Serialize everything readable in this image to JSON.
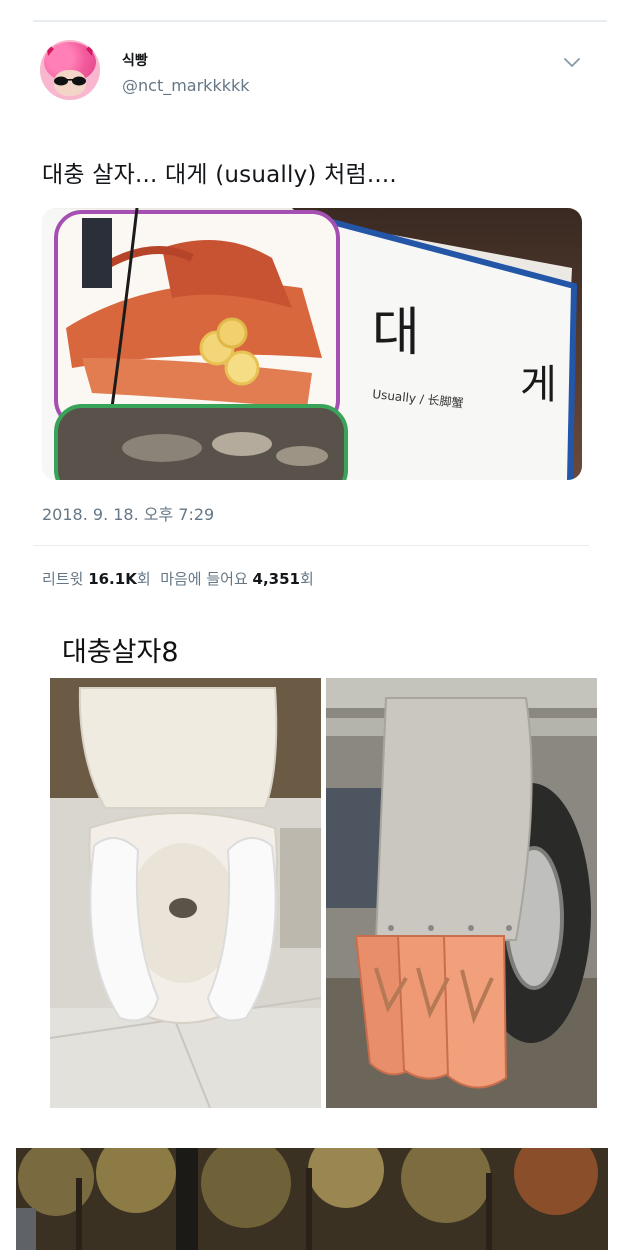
{
  "tweet": {
    "display_name": "식빵",
    "handle": "@nct_markkkkk",
    "text": "대충 살자... 대게 (usually) 처럼....",
    "timestamp": "2018. 9. 18. 오후 7:29",
    "retweets_label": "리트윗",
    "retweets_count": "16.1K",
    "retweets_unit": "회",
    "likes_label": "마음에 들어요",
    "likes_count": "4,351",
    "likes_unit": "회"
  },
  "photo_sign": {
    "char_1": "대",
    "char_2": "게",
    "subtitle": "Usually / 长脚蟹"
  },
  "post": {
    "caption": "대충살자8"
  },
  "colors": {
    "secondary_text": "#657786",
    "divider": "#e6ecf0",
    "sign_purple": "#a64fb3",
    "sign_blue": "#2456a8"
  }
}
